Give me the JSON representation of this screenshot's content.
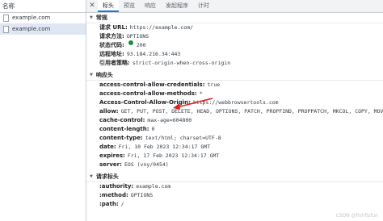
{
  "left": {
    "header": "名称",
    "requests": [
      {
        "name": "example.com"
      },
      {
        "name": "example.com"
      }
    ]
  },
  "tabs": {
    "close": "✕",
    "items": [
      {
        "label": "标头"
      },
      {
        "label": "预览"
      },
      {
        "label": "响应"
      },
      {
        "label": "发起程序"
      },
      {
        "label": "计时"
      }
    ]
  },
  "general": {
    "title": "常规",
    "rows": [
      {
        "key": "请求 URL:",
        "value": "https://example.com/"
      },
      {
        "key": "请求方法:",
        "value": "OPTIONS"
      },
      {
        "key": "状态代码:",
        "value": "200"
      },
      {
        "key": "远程地址:",
        "value": "93.184.216.34:443"
      },
      {
        "key": "引用者策略:",
        "value": "strict-origin-when-cross-origin"
      }
    ]
  },
  "response": {
    "title": "响应头",
    "rows": [
      {
        "key": "access-control-allow-credentials:",
        "value": "true"
      },
      {
        "key": "access-control-allow-methods:",
        "value": "*"
      },
      {
        "key": "Access-Control-Allow-Origin:",
        "value": "https://webbrowsertools.com"
      },
      {
        "key": "allow:",
        "value": "GET, PUT, POST, DELETE, HEAD, OPTIONS, PATCH, PROPFIND, PROPPATCH, MKCOL, COPY, MOVE, LOCK"
      },
      {
        "key": "cache-control:",
        "value": "max-age=604800"
      },
      {
        "key": "content-length:",
        "value": "0"
      },
      {
        "key": "content-type:",
        "value": "text/html; charset=UTF-8"
      },
      {
        "key": "date:",
        "value": "Fri, 10 Feb 2023 12:34:17 GMT"
      },
      {
        "key": "expires:",
        "value": "Fri, 17 Feb 2023 12:34:17 GMT"
      },
      {
        "key": "server:",
        "value": "EOS (vny/0454)"
      }
    ]
  },
  "request": {
    "title": "请求标头",
    "rows": [
      {
        "key": ":authority:",
        "value": "example.com"
      },
      {
        "key": ":method:",
        "value": "OPTIONS"
      },
      {
        "key": ":path:",
        "value": "/"
      }
    ]
  },
  "watermark": "CSDN @fishfisfun",
  "colors": {
    "accent": "#1a73e8",
    "status_ok": "#1e8e3e",
    "arrow": "#e02020",
    "selected_row": "#dfe7f4"
  }
}
